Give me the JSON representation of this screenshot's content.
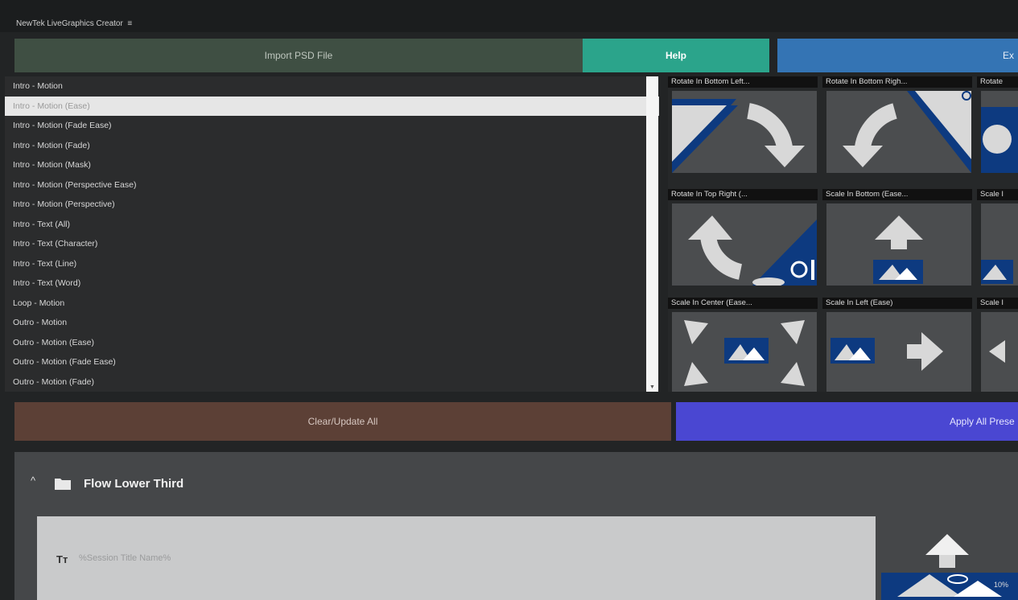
{
  "window": {
    "title": "NewTek LiveGraphics Creator",
    "menu_glyph": "≡"
  },
  "toolbar": {
    "import_label": "Import PSD File",
    "help_label": "Help",
    "export_label": "Ex"
  },
  "animations": {
    "items": [
      {
        "label": "Intro - Motion",
        "selected": false
      },
      {
        "label": "Intro - Motion (Ease)",
        "selected": true
      },
      {
        "label": "Intro - Motion (Fade Ease)",
        "selected": false
      },
      {
        "label": "Intro - Motion (Fade)",
        "selected": false
      },
      {
        "label": "Intro - Motion (Mask)",
        "selected": false
      },
      {
        "label": "Intro - Motion (Perspective Ease)",
        "selected": false
      },
      {
        "label": "Intro - Motion (Perspective)",
        "selected": false
      },
      {
        "label": "Intro - Text (All)",
        "selected": false
      },
      {
        "label": "Intro - Text (Character)",
        "selected": false
      },
      {
        "label": "Intro - Text (Line)",
        "selected": false
      },
      {
        "label": "Intro - Text (Word)",
        "selected": false
      },
      {
        "label": "Loop - Motion",
        "selected": false
      },
      {
        "label": "Outro - Motion",
        "selected": false
      },
      {
        "label": "Outro - Motion (Ease)",
        "selected": false
      },
      {
        "label": "Outro - Motion (Fade Ease)",
        "selected": false
      },
      {
        "label": "Outro - Motion (Fade)",
        "selected": false
      }
    ]
  },
  "presets": [
    {
      "label": "Rotate In Bottom Left...",
      "icon": "rotate-bottom-left-icon"
    },
    {
      "label": "Rotate In Bottom Righ...",
      "icon": "rotate-bottom-right-icon"
    },
    {
      "label": "Rotate",
      "icon": "rotate-icon"
    },
    {
      "label": "Rotate In Top Right (...",
      "icon": "rotate-top-right-icon"
    },
    {
      "label": "Scale In Bottom (Ease...",
      "icon": "scale-bottom-icon"
    },
    {
      "label": "Scale I",
      "icon": "scale-icon"
    },
    {
      "label": "Scale In Center (Ease...",
      "icon": "scale-center-icon"
    },
    {
      "label": "Scale In Left (Ease)",
      "icon": "scale-left-icon"
    },
    {
      "label": "Scale I",
      "icon": "scale-icon"
    }
  ],
  "actions": {
    "clear_label": "Clear/Update All",
    "apply_label": "Apply All Prese"
  },
  "group": {
    "title": "Flow Lower Third",
    "caret": "^"
  },
  "layer": {
    "type_glyph": "Tт",
    "placeholder": "%Session Title Name%",
    "preview_percent": "10%"
  },
  "colors": {
    "accent_blue": "#0d3a80",
    "help": "#2ba48b",
    "export": "#3474b4",
    "apply": "#4a47d2",
    "clear": "#5c4036",
    "import": "#3f4f43"
  }
}
